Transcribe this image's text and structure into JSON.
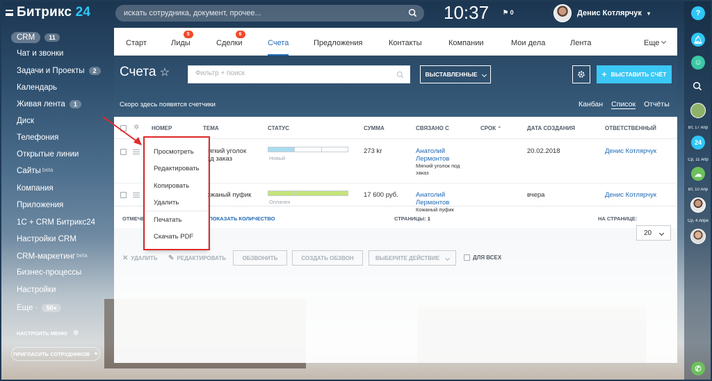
{
  "topbar": {
    "logo_text": "Битрикс",
    "logo_num": "24",
    "search_placeholder": "искать сотрудника, документ, прочее...",
    "clock": "10:37",
    "flag_count": "0",
    "user_name": "Денис Котлярчук"
  },
  "left_menu": {
    "items": [
      {
        "label": "CRM",
        "count": "11"
      },
      {
        "label": "Чат и звонки"
      },
      {
        "label": "Задачи и Проекты",
        "count": "2"
      },
      {
        "label": "Календарь"
      },
      {
        "label": "Живая лента",
        "count": "1"
      },
      {
        "label": "Диск"
      },
      {
        "label": "Телефония"
      },
      {
        "label": "Открытые линии"
      },
      {
        "label": "Сайты",
        "beta": "beta"
      },
      {
        "label": "Компания"
      },
      {
        "label": "Приложения"
      },
      {
        "label": "1С + CRM Битрикс24"
      },
      {
        "label": "Настройки CRM"
      },
      {
        "label": "CRM-маркетинг",
        "beta": "beta"
      },
      {
        "label": "Бизнес-процессы"
      },
      {
        "label": "Настройки"
      },
      {
        "label": "Еще ·",
        "count": "50+"
      }
    ],
    "setup_label": "НАСТРОИТЬ МЕНЮ",
    "invite_label": "ПРИГЛАСИТЬ СОТРУДНИКОВ"
  },
  "tabs": [
    {
      "label": "Старт"
    },
    {
      "label": "Лиды",
      "badge": "5"
    },
    {
      "label": "Сделки",
      "badge": "6"
    },
    {
      "label": "Счета",
      "active": true
    },
    {
      "label": "Предложения"
    },
    {
      "label": "Контакты"
    },
    {
      "label": "Компании"
    },
    {
      "label": "Мои дела"
    },
    {
      "label": "Лента"
    },
    {
      "label": "Еще"
    }
  ],
  "toolbar": {
    "page_title": "Счета",
    "filter_placeholder": "Фильтр + поиск",
    "status_dropdown": "ВЫСТАВЛЕННЫЕ",
    "add_button": "ВЫСТАВИТЬ СЧЁТ"
  },
  "counters_text": "Скоро здесь появятся счетчики",
  "views": [
    "Канбан",
    "Список",
    "Отчёты"
  ],
  "grid": {
    "columns": [
      "НОМЕР",
      "ТЕМА",
      "СТАТУС",
      "СУММА",
      "СВЯЗАНО С",
      "СРОК",
      "ДАТА СОЗДАНИЯ",
      "ОТВЕТСТВЕННЫЙ"
    ],
    "rows": [
      {
        "topic_line1": "Мягкий уголок",
        "topic_line2": "под заказ",
        "status": "Новый",
        "status_progress": 0.33,
        "status_color": "#a8dcf0",
        "sum": "273 kr",
        "contact_first": "Анатолий",
        "contact_last": "Лермонтов",
        "deal_line1": "Мягкий уголок под",
        "deal_line2": "заказ",
        "date": "20.02.2018",
        "owner": "Денис Котлярчук"
      },
      {
        "topic_line1": "Кожаный пуфик",
        "topic_line2": "",
        "status": "Оплачен",
        "status_progress": 1,
        "status_color": "#c5e37a",
        "sum": "17 600 руб.",
        "contact_first": "Анатолий",
        "contact_last": "Лермонтов",
        "deal_line1": "Кожаный пуфик",
        "deal_line2": "",
        "date": "вчера",
        "owner": "Денис Котлярчук"
      }
    ],
    "footer": {
      "checked_prefix": "ОТМЕЧЕ",
      "show_count": "О: ПОКАЗАТЬ КОЛИЧЕСТВО",
      "pages_label": "СТРАНИЦЫ:",
      "pages_value": "1",
      "per_page_label": "НА СТРАНИЦЕ:",
      "per_page_value": "20"
    }
  },
  "context_menu": {
    "items": [
      "Просмотреть",
      "Редактировать",
      "Копировать",
      "Удалить",
      "Печатать",
      "Скачать PDF"
    ]
  },
  "actions": {
    "delete": "УДАЛИТЬ",
    "edit": "РЕДАКТИРОВАТЬ",
    "call": "ОБЗВОНИТЬ",
    "create_call": "СОЗДАТЬ ОБЗВОН",
    "choose_action": "ВЫБЕРИТЕ ДЕЙСТВИЕ",
    "for_all": "ДЛЯ ВСЕХ"
  },
  "right_bar": {
    "help": "?",
    "dates": [
      "Вт, 17 Апр",
      "Ср, 11 Апр",
      "Вт, 10 Апр",
      "Ср, 4 Апре"
    ]
  }
}
